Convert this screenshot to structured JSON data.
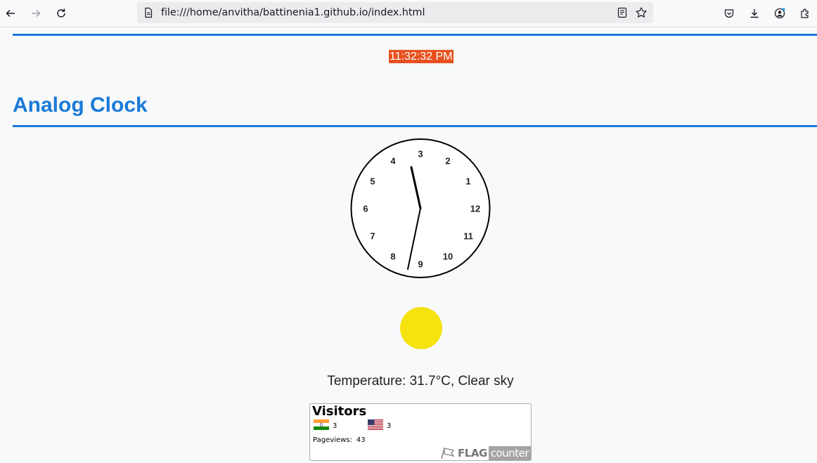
{
  "browser": {
    "url": "file:///home/anvitha/battinenia1.github.io/index.html",
    "toolbar_icons": [
      "back-icon",
      "forward-icon",
      "reload-icon",
      "page-icon",
      "reader-view-icon",
      "bookmark-star-icon",
      "pocket-icon",
      "downloads-icon",
      "account-icon",
      "extensions-icon"
    ]
  },
  "page": {
    "digital_time": "11:32:32 PM",
    "heading": "Analog Clock",
    "accent_color": "#1a7ad8",
    "digital_bg_color": "#e7511f"
  },
  "clock": {
    "numbers": [
      "12",
      "1",
      "2",
      "3",
      "4",
      "5",
      "6",
      "7",
      "8",
      "9",
      "10",
      "11"
    ]
  },
  "weather": {
    "text": "Temperature: 31.7°C, Clear sky",
    "sun_color": "#f5e20e"
  },
  "flag_counter": {
    "title": "Visitors",
    "countries": [
      {
        "flag": "india-flag-icon",
        "count": "3"
      },
      {
        "flag": "usa-flag-icon",
        "count": "3"
      }
    ],
    "pageviews_label": "Pageviews:",
    "pageviews_value": "43",
    "brand_flag": "FLAG",
    "brand_counter": "counter"
  }
}
